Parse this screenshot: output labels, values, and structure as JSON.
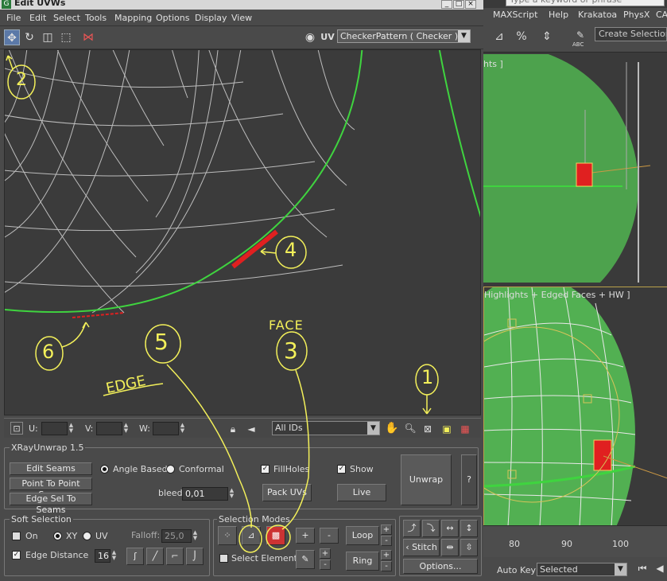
{
  "window": {
    "title": "Edit UVWs",
    "icon": "G",
    "min": "_",
    "max": "□",
    "close": "×"
  },
  "menu": [
    "File",
    "Edit",
    "Select",
    "Tools",
    "Mapping",
    "Options",
    "Display",
    "View"
  ],
  "toolbar": {
    "uv_label": "UV",
    "map_select": "CheckerPattern  ( Checker )"
  },
  "coords": {
    "u_label": "U:",
    "v_label": "V:",
    "w_label": "W:",
    "ids": "All IDs"
  },
  "xray": {
    "title": "XRayUnwrap 1.5",
    "edit_seams": "Edit Seams",
    "point_to_point": "Point To Point Seam",
    "edge_sel": "Edge Sel To Seams",
    "angle_based": "Angle Based",
    "conformal": "Conformal",
    "fillholes": "FillHoles",
    "show": "Show",
    "bleed_label": "bleed",
    "bleed_value": "0,01",
    "pack_uvs": "Pack UVs",
    "live": "Live",
    "unwrap": "Unwrap",
    "help": "?"
  },
  "soft": {
    "title": "Soft Selection",
    "on": "On",
    "xy": "XY",
    "uv": "UV",
    "falloff_label": "Falloff:",
    "falloff_value": "25,0",
    "edge_distance": "Edge Distance",
    "edge_value": "16"
  },
  "selmodes": {
    "title": "Selection Modes",
    "select_element": "Select Element",
    "plus": "+",
    "minus": "-",
    "loop": "Loop",
    "ring": "Ring"
  },
  "stitch": {
    "stitch": "Stitch",
    "options": "Options..."
  },
  "annotations": {
    "n1": "1",
    "n2": "2",
    "n3": "3",
    "n4": "4",
    "n5": "5",
    "n6": "6",
    "face": "FACE",
    "edge": "EDGE"
  },
  "right": {
    "search_placeholder": "Type a keyword or phrase",
    "menu": [
      "MAXScript",
      "Help",
      "Krakatoa",
      "PhysX",
      "CA"
    ],
    "create_selection": "Create Selection Se",
    "abc": "ABC",
    "vp1_label": "hts ]",
    "vp2_label": "Highlights + Edged Faces + HW ]",
    "ticks": [
      "80",
      "90",
      "100"
    ],
    "auto_key": "Auto Key",
    "selected": "Selected"
  },
  "colors": {
    "accent_green": "#3fd43f",
    "selection_red": "#e02020",
    "annotation_yellow": "#f3f05a"
  }
}
